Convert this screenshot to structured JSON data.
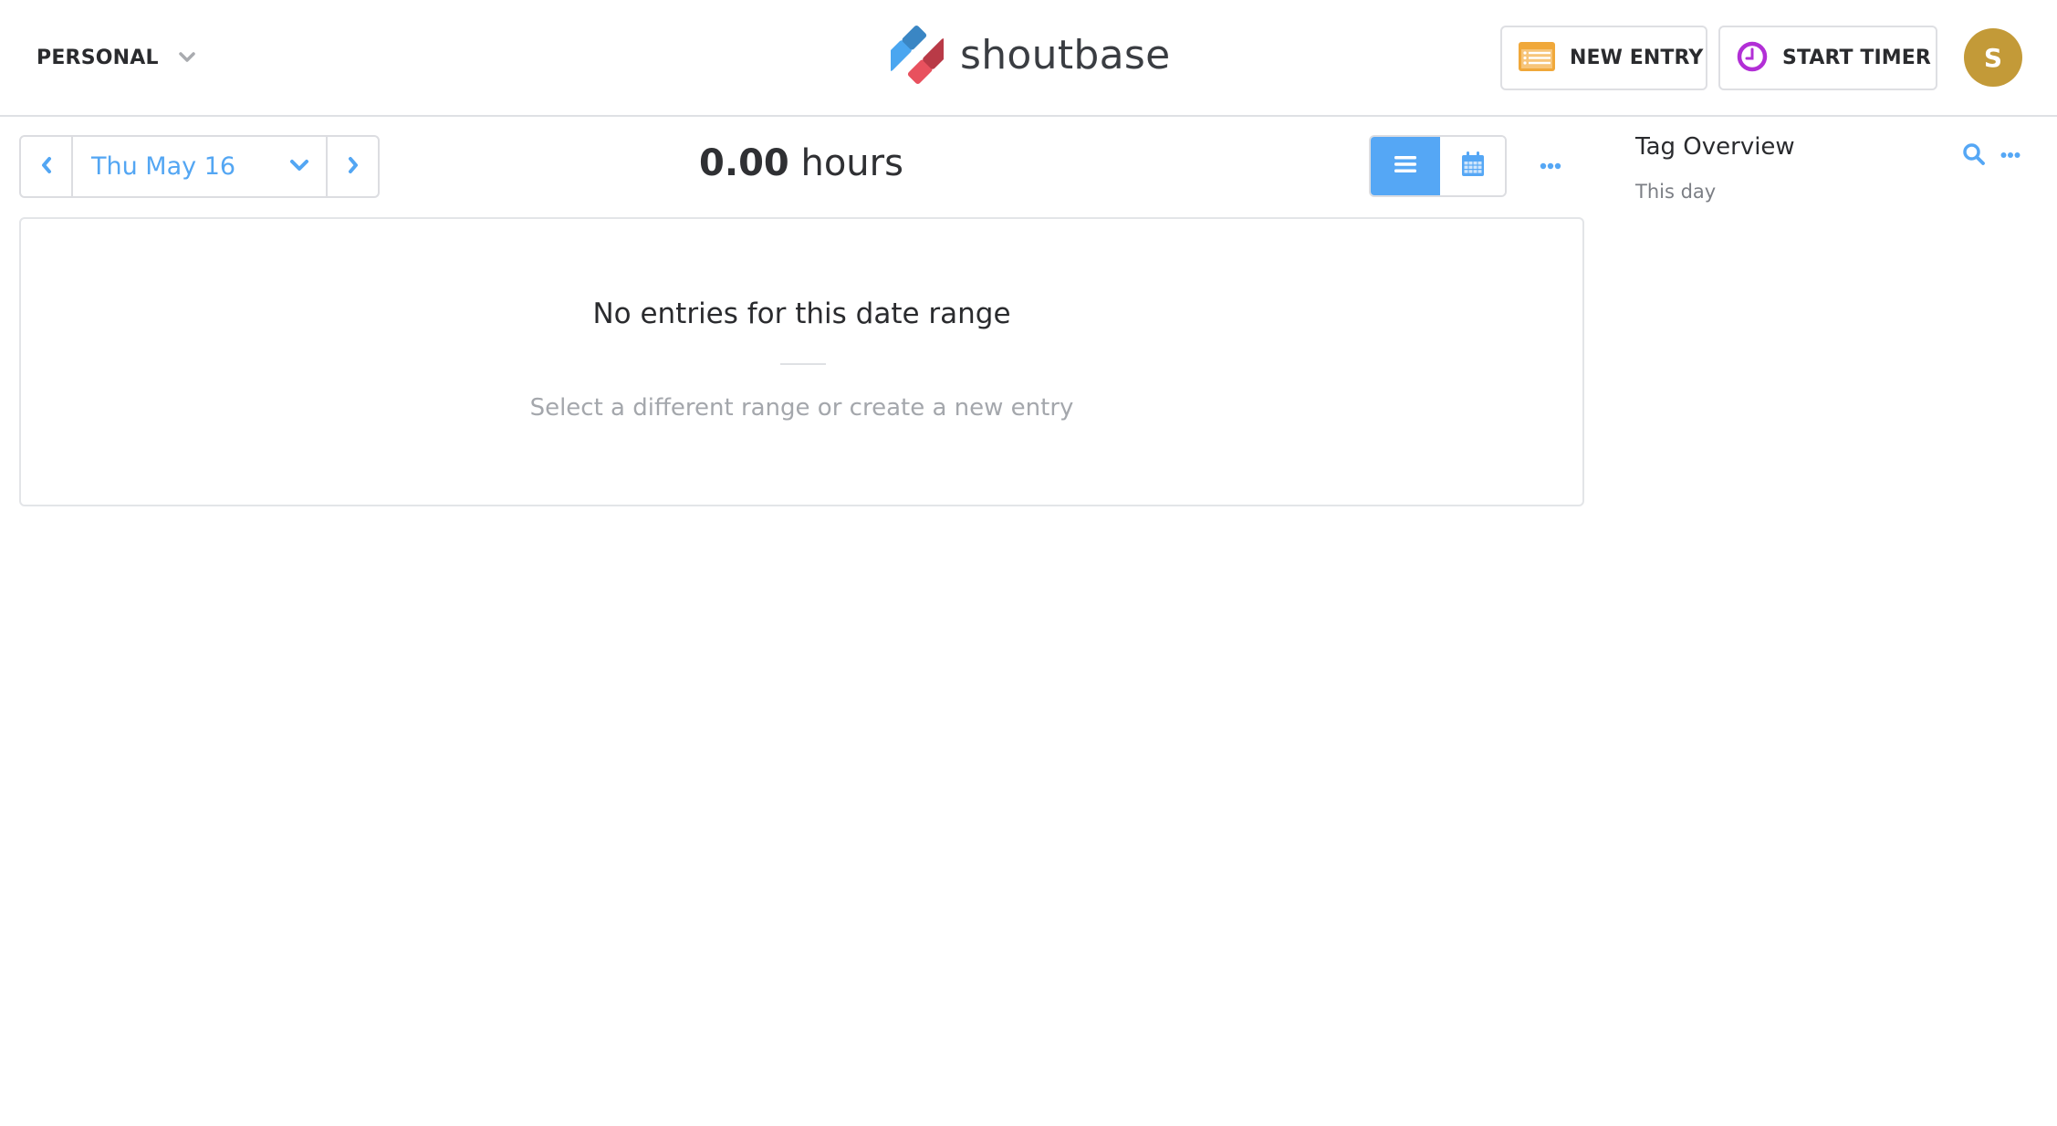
{
  "header": {
    "workspace": {
      "label": "PERSONAL",
      "icon": "chevron-down-icon"
    },
    "brand": {
      "name": "shoutbase",
      "logo_colors": {
        "blue": "#4aa6f0",
        "blue_dark": "#3a86c4",
        "red": "#e8515e",
        "red_dark": "#b93a47"
      }
    },
    "new_entry": {
      "label": "NEW ENTRY",
      "icon": "entry-list-icon",
      "icon_color": "#f0a83a"
    },
    "start_timer": {
      "label": "START TIMER",
      "icon": "clock-icon",
      "icon_color": "#b22fd6"
    },
    "avatar": {
      "initial": "S",
      "color": "#c39a38"
    }
  },
  "toolbar": {
    "date_nav": {
      "prev_icon": "chevron-left-icon",
      "date_label": "Thu May 16",
      "dropdown_icon": "chevron-down-icon",
      "next_icon": "chevron-right-icon"
    },
    "total": {
      "value": "0.00",
      "unit": "hours"
    },
    "view_toggle": [
      {
        "name": "list",
        "icon": "list-icon",
        "active": true
      },
      {
        "name": "calendar",
        "icon": "calendar-icon",
        "active": false
      }
    ],
    "more_icon": "ellipsis-icon",
    "accent_color": "#55a7f5"
  },
  "empty_state": {
    "title": "No entries for this date range",
    "subtitle": "Select a different range or create a new entry"
  },
  "tag_overview": {
    "title": "Tag Overview",
    "range_label": "This day",
    "search_icon": "search-icon",
    "more_icon": "ellipsis-icon"
  }
}
